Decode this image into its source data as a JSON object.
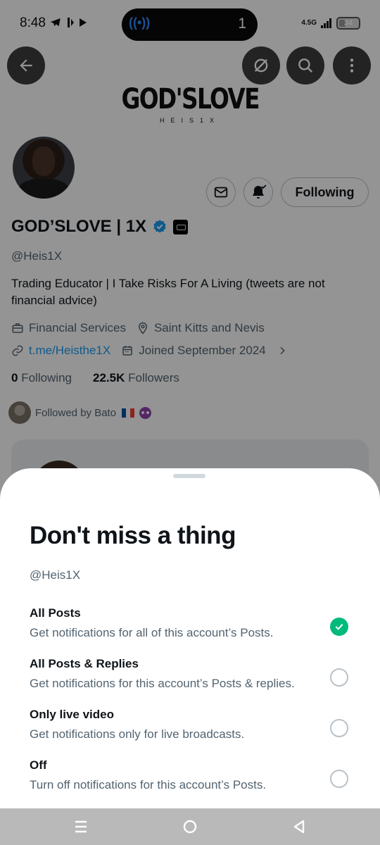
{
  "status_bar": {
    "time": "8:48",
    "live_count": "1",
    "network": "4.5G",
    "battery_percent": "34",
    "battery_level": 0.34
  },
  "profile": {
    "banner_title": "GOD'SLOVE",
    "banner_subtitle": "HEIS1X",
    "display_name": "GOD’SLOVE | 1X",
    "handle": "@Heis1X",
    "following_button": "Following",
    "bio": "Trading Educator | I Take Risks For A Living   (tweets are not financial advice)",
    "category": "Financial Services",
    "location": "Saint Kitts and Nevis",
    "link": "t.me/Heisthe1X",
    "joined": "Joined September 2024",
    "following_count": "0",
    "following_label": "Following",
    "followers_count": "22.5K",
    "followers_label": "Followers",
    "followed_by": "Followed by Bato"
  },
  "sheet": {
    "title": "Don't miss a thing",
    "handle": "@Heis1X",
    "options": [
      {
        "title": "All Posts",
        "desc": "Get notifications for all of this account’s Posts.",
        "selected": true
      },
      {
        "title": "All Posts & Replies",
        "desc": "Get notifications for this account’s Posts & replies.",
        "selected": false
      },
      {
        "title": "Only live video",
        "desc": "Get notifications only for live broadcasts.",
        "selected": false
      },
      {
        "title": "Off",
        "desc": "Turn off notifications for this account’s Posts.",
        "selected": false
      }
    ]
  },
  "colors": {
    "accent_blue": "#1d9bf0",
    "check_green": "#00ba7c",
    "secondary_text": "#536471"
  },
  "icons": [
    "back-arrow-icon",
    "grok-icon",
    "search-icon",
    "more-vertical-icon",
    "mail-icon",
    "bell-check-icon",
    "verified-icon",
    "briefcase-icon",
    "location-pin-icon",
    "link-icon",
    "calendar-icon",
    "chevron-right-icon",
    "checkmark-icon",
    "menu-icon",
    "home-circle-icon",
    "back-triangle-icon"
  ]
}
